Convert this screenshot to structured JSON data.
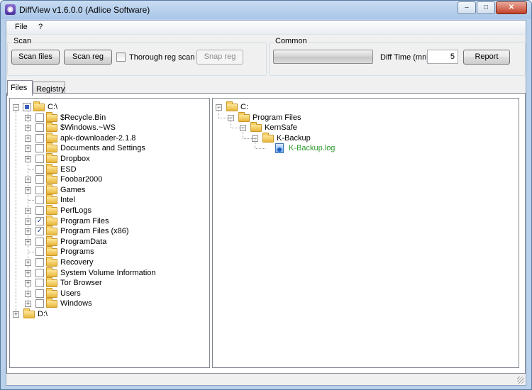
{
  "window": {
    "title": "DiffView v1.6.0.0 (Adlice Software)",
    "icon": "app-icon",
    "controls": {
      "minimize": "–",
      "maximize": "□",
      "close": "✕"
    }
  },
  "menu": [
    {
      "label": "File"
    },
    {
      "label": "?"
    }
  ],
  "scan_group": {
    "label": "Scan",
    "scan_files": "Scan files",
    "scan_reg": "Scan reg",
    "thorough_label": "Thorough reg scan",
    "thorough_checked": false,
    "snap_reg": "Snap reg"
  },
  "common_group": {
    "label": "Common",
    "diff_time_label": "Diff Time (mn)",
    "diff_time_value": "5",
    "report": "Report"
  },
  "tabs": [
    {
      "label": "Files",
      "active": true
    },
    {
      "label": "Registry",
      "active": false
    }
  ],
  "left_tree": {
    "root": {
      "label": "C:\\",
      "check": "partial",
      "expanded": true
    },
    "children": [
      {
        "label": "$Recycle.Bin",
        "expander": true,
        "checked": false
      },
      {
        "label": "$Windows.~WS",
        "expander": true,
        "checked": false
      },
      {
        "label": "apk-downloader-2.1.8",
        "expander": true,
        "checked": false
      },
      {
        "label": "Documents and Settings",
        "expander": true,
        "checked": false
      },
      {
        "label": "Dropbox",
        "expander": true,
        "checked": false
      },
      {
        "label": "ESD",
        "expander": false,
        "checked": false
      },
      {
        "label": "Foobar2000",
        "expander": true,
        "checked": false
      },
      {
        "label": "Games",
        "expander": true,
        "checked": false
      },
      {
        "label": "Intel",
        "expander": false,
        "checked": false
      },
      {
        "label": "PerfLogs",
        "expander": true,
        "checked": false
      },
      {
        "label": "Program Files",
        "expander": true,
        "checked": true
      },
      {
        "label": "Program Files (x86)",
        "expander": true,
        "checked": true
      },
      {
        "label": "ProgramData",
        "expander": true,
        "checked": false
      },
      {
        "label": "Programs",
        "expander": false,
        "checked": false
      },
      {
        "label": "Recovery",
        "expander": true,
        "checked": false
      },
      {
        "label": "System Volume Information",
        "expander": true,
        "checked": false
      },
      {
        "label": "Tor Browser",
        "expander": true,
        "checked": false
      },
      {
        "label": "Users",
        "expander": true,
        "checked": false
      },
      {
        "label": "Windows",
        "expander": true,
        "checked": false
      }
    ],
    "second_root": {
      "label": "D:\\",
      "expanded": false
    }
  },
  "right_tree": [
    {
      "label": "C:",
      "level": 0,
      "type": "folder"
    },
    {
      "label": "Program Files",
      "level": 1,
      "type": "folder"
    },
    {
      "label": "KernSafe",
      "level": 2,
      "type": "folder"
    },
    {
      "label": "K-Backup",
      "level": 3,
      "type": "folder"
    },
    {
      "label": "K-Backup.log",
      "level": 4,
      "type": "file",
      "color": "#2a9a2a"
    }
  ]
}
